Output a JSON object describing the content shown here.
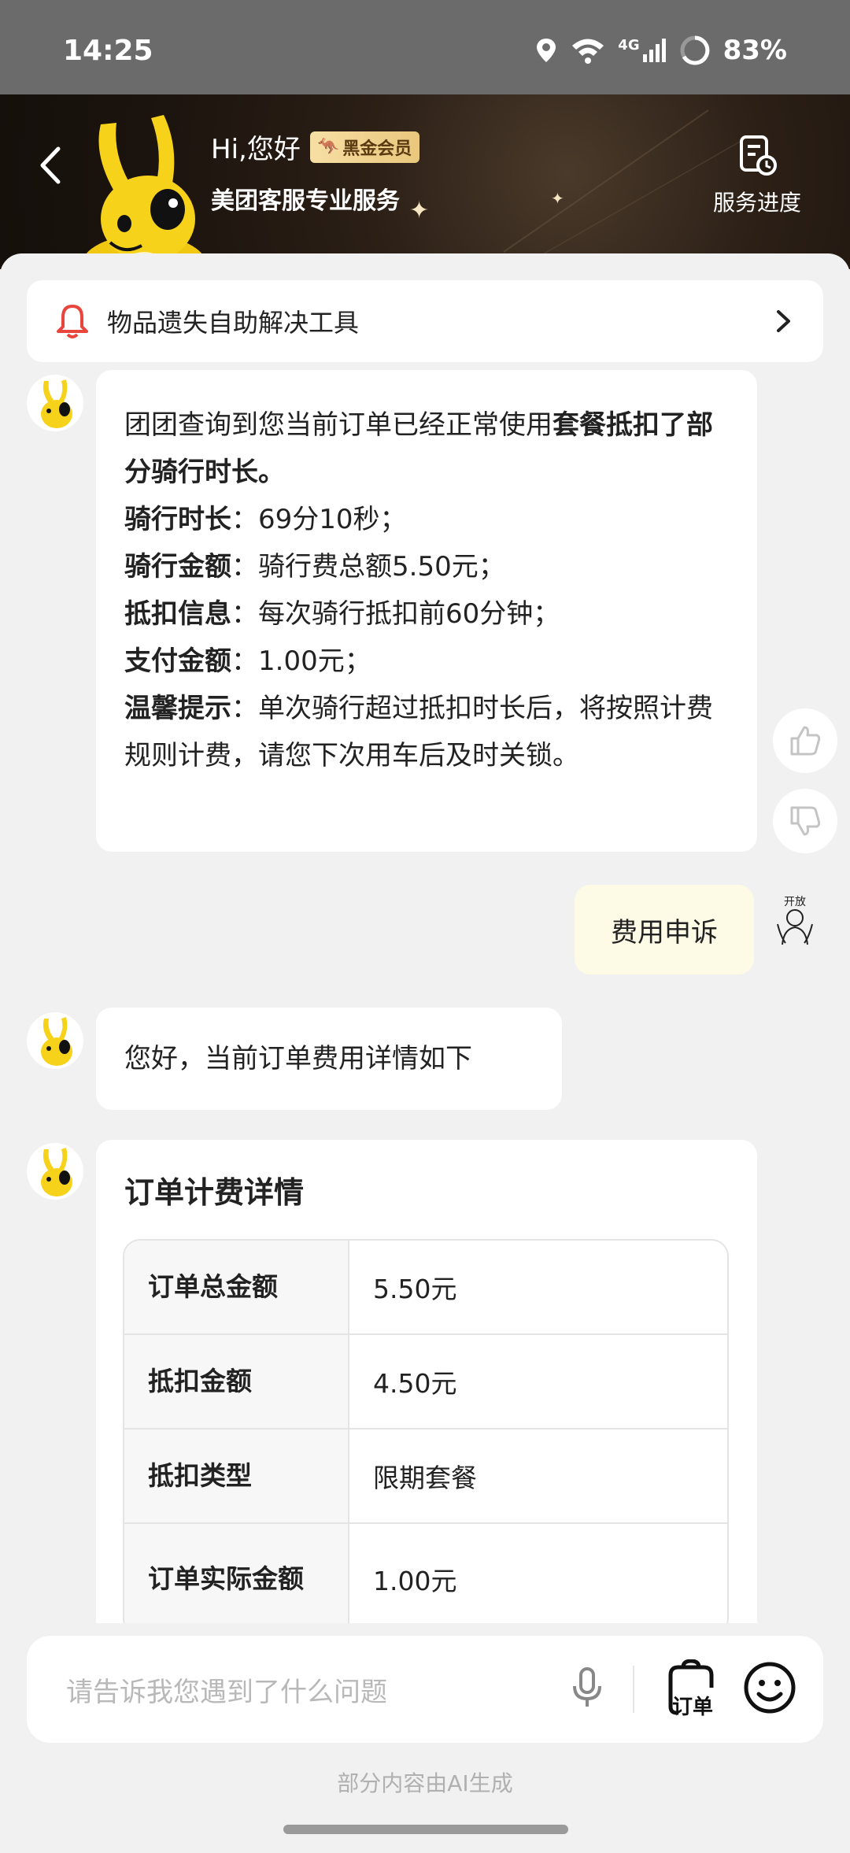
{
  "status_bar": {
    "time": "14:25",
    "network": "4G",
    "battery": "83%"
  },
  "header": {
    "greeting": "Hi,您好",
    "vip_badge": "黑金会员",
    "subtitle": "美团客服专业服务",
    "progress_label": "服务进度"
  },
  "tool_banner": {
    "label": "物品遗失自助解决工具"
  },
  "messages": {
    "bot1": {
      "intro": "团团查询到您当前订单已经正常使用",
      "intro_bold": "套餐抵扣了部分骑行时长。",
      "lines": [
        {
          "label": "骑行时长",
          "sep": "：",
          "value": "69分10秒；"
        },
        {
          "label": "骑行金额",
          "sep": "：",
          "value": "骑行费总额5.50元；"
        },
        {
          "label": "抵扣信息",
          "sep": "：",
          "value": "每次骑行抵扣前60分钟；"
        },
        {
          "label": "支付金额",
          "sep": "：",
          "value": "1.00元；"
        },
        {
          "label": "温馨提示",
          "sep": "：",
          "value": "单次骑行超过抵扣时长后，将按照计费规则计费，请您下次用车后及时关锁。"
        }
      ]
    },
    "user1": "费用申诉",
    "bot2": "您好，当前订单费用详情如下",
    "bot3": {
      "title": "订单计费详情",
      "rows": [
        {
          "k": "订单总金额",
          "v": "5.50元"
        },
        {
          "k": "抵扣金额",
          "v": "4.50元"
        },
        {
          "k": "抵扣类型",
          "v": "限期套餐"
        },
        {
          "k": "订单实际金额",
          "v": "1.00元"
        }
      ]
    }
  },
  "user_avatar_text": "开放",
  "input": {
    "placeholder": "请告诉我您遇到了什么问题",
    "order_label": "订单"
  },
  "footer_note": "部分内容由AI生成",
  "colors": {
    "header_bg": "#1c140e",
    "mascot_yellow": "#f7d21a",
    "vip_gold": "#e9c77d",
    "bell_red": "#e8453c",
    "user_bubble": "#fdfbe6"
  }
}
